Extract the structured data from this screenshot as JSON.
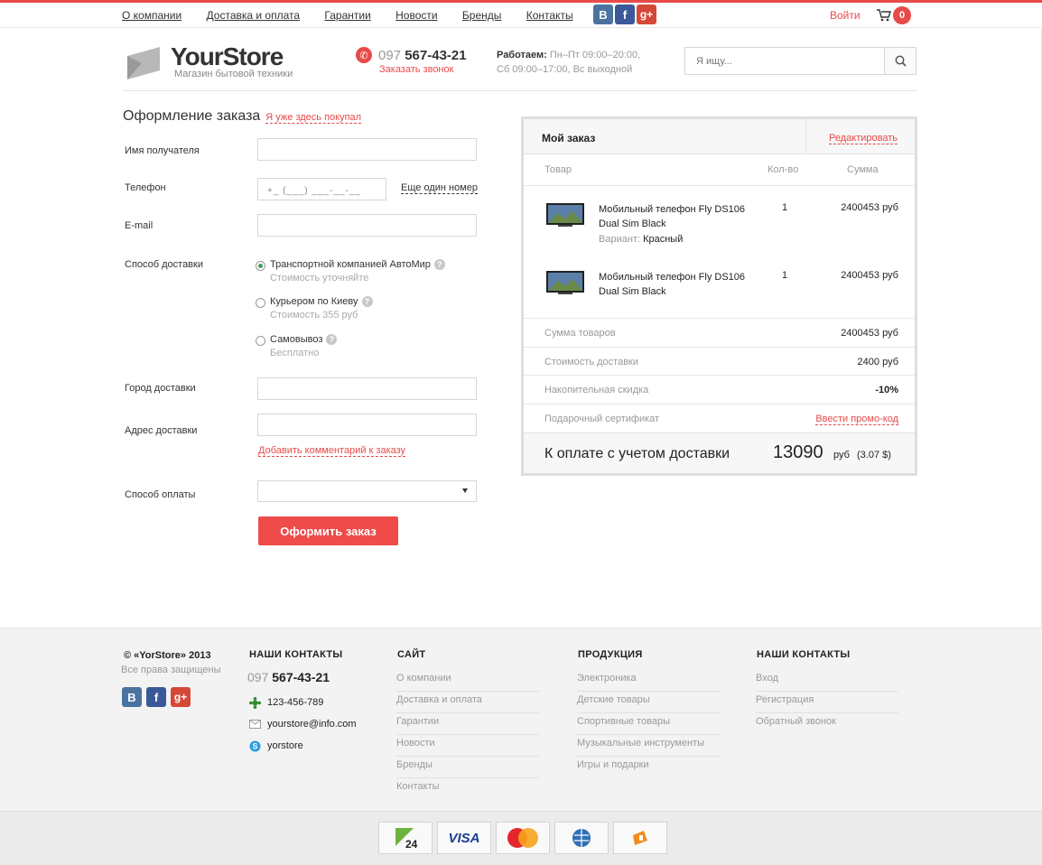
{
  "topnav": {
    "links": [
      "О компании",
      "Доставка и оплата",
      "Гарантии",
      "Новости",
      "Бренды",
      "Контакты"
    ],
    "social": [
      "В",
      "f",
      "g+"
    ],
    "login": "Войти",
    "cart_count": "0"
  },
  "header": {
    "logo_name": "YourStore",
    "logo_sub": "Магазин бытовой техники",
    "phone_code": "097",
    "phone_number": "567-43-21",
    "callback": "Заказать звонок",
    "hours_label": "Работаем:",
    "hours_line1": "Пн–Пт 09:00–20:00,",
    "hours_line2": "Сб 09:00–17:00, Вс выходной",
    "search_placeholder": "Я ищу..."
  },
  "form": {
    "title": "Оформление заказа",
    "already": "Я уже здесь покупал",
    "name_label": "Имя получателя",
    "phone_label": "Телефон",
    "phone_mask": "+_ (___) ___-__-__",
    "another_number": "Еще один номер",
    "email_label": "E-mail",
    "delivery_label": "Способ доставки",
    "delivery_options": [
      {
        "label": "Транспортной компанией АвтоМир",
        "sub": "Стоимость уточняйте"
      },
      {
        "label": "Курьером по Киеву",
        "sub": "Стоимость 355 руб"
      },
      {
        "label": "Самовывоз",
        "sub": "Бесплатно"
      }
    ],
    "city_label": "Город доставки",
    "address_label": "Адрес доставки",
    "add_comment": "Добавить комментарий к заказу",
    "payment_label": "Способ оплаты",
    "submit": "Оформить заказ"
  },
  "order": {
    "title": "Мой заказ",
    "edit": "Редактировать",
    "col_item": "Товар",
    "col_qty": "Кол-во",
    "col_sum": "Сумма",
    "items": [
      {
        "name": "Мобильный телефон Fly DS106 Dual Sim Black",
        "variant_label": "Вариант:",
        "variant": "Красный",
        "qty": "1",
        "sum": "2400453 руб"
      },
      {
        "name": "Мобильный телефон Fly DS106 Dual Sim Black",
        "qty": "1",
        "sum": "2400453 руб"
      }
    ],
    "summary": [
      {
        "label": "Сумма товаров",
        "value": "2400453 руб"
      },
      {
        "label": "Стоимость доставки",
        "value": "2400 руб"
      },
      {
        "label": "Накопительная скидка",
        "value": "-10%"
      },
      {
        "label": "Подарочный сертификат",
        "value": "Ввести промо-код"
      }
    ],
    "total_label": "К оплате с учетом доставки",
    "total_amount": "13090",
    "total_currency": "руб",
    "total_usd": "(3.07 $)"
  },
  "footer": {
    "copyright": "© «YorStore» 2013",
    "rights": "Все права защищены",
    "contacts_title": "НАШИ КОНТАКТЫ",
    "phone_code": "097",
    "phone_number": "567-43-21",
    "icq": "123-456-789",
    "email": "yourstore@info.com",
    "skype": "yorstore",
    "site_title": "САЙТ",
    "site_links": [
      "О компании",
      "Доставка и оплата",
      "Гарантии",
      "Новости",
      "Бренды",
      "Контакты"
    ],
    "products_title": "ПРОДУКЦИЯ",
    "products_links": [
      "Электроника",
      "Детские товары",
      "Спортивные товары",
      "Музыкальные инструменты",
      "Игры и подарки"
    ],
    "contacts2_title": "НАШИ КОНТАКТЫ",
    "contacts2_links": [
      "Вход",
      "Регистрация",
      "Обратный звонок"
    ]
  },
  "payments": [
    "privat24-icon",
    "visa-icon",
    "mastercard-icon",
    "webmoney-icon",
    "yandex-money-icon"
  ],
  "colors": {
    "accent": "#e84a4a",
    "button": "#ef4b4b"
  }
}
